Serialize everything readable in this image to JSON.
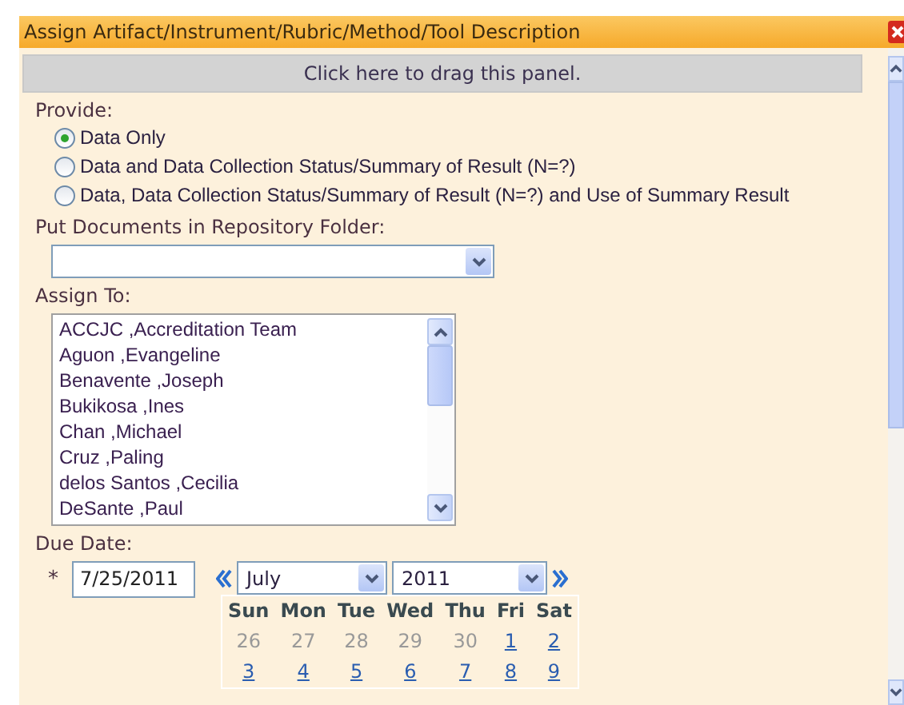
{
  "window": {
    "title": "Assign Artifact/Instrument/Rubric/Method/Tool Description"
  },
  "drag_bar": {
    "label": "Click here to drag this panel."
  },
  "provide": {
    "label": "Provide:",
    "options": [
      {
        "label": "Data Only",
        "selected": true
      },
      {
        "label": "Data and Data Collection Status/Summary of Result (N=?)",
        "selected": false
      },
      {
        "label": "Data, Data Collection Status/Summary of Result (N=?) and Use of Summary Result",
        "selected": false
      }
    ]
  },
  "repository": {
    "label": "Put Documents in Repository Folder:"
  },
  "assign_to": {
    "label": "Assign To:",
    "items": [
      "ACCJC ,Accreditation Team",
      "Aguon ,Evangeline",
      "Benavente ,Joseph",
      "Bukikosa ,Ines",
      "Chan ,Michael",
      "Cruz ,Paling",
      "delos Santos ,Cecilia",
      "DeSante ,Paul"
    ]
  },
  "due_date": {
    "label": "Due Date:",
    "required_mark": "*",
    "value": "7/25/2011",
    "month": "July",
    "year": "2011",
    "weekdays": [
      "Sun",
      "Mon",
      "Tue",
      "Wed",
      "Thu",
      "Fri",
      "Sat"
    ],
    "weeks": [
      [
        {
          "day": "26",
          "in_month": false
        },
        {
          "day": "27",
          "in_month": false
        },
        {
          "day": "28",
          "in_month": false
        },
        {
          "day": "29",
          "in_month": false
        },
        {
          "day": "30",
          "in_month": false
        },
        {
          "day": "1",
          "in_month": true
        },
        {
          "day": "2",
          "in_month": true
        }
      ],
      [
        {
          "day": "3",
          "in_month": true
        },
        {
          "day": "4",
          "in_month": true
        },
        {
          "day": "5",
          "in_month": true
        },
        {
          "day": "6",
          "in_month": true
        },
        {
          "day": "7",
          "in_month": true
        },
        {
          "day": "8",
          "in_month": true
        },
        {
          "day": "9",
          "in_month": true
        }
      ]
    ]
  }
}
